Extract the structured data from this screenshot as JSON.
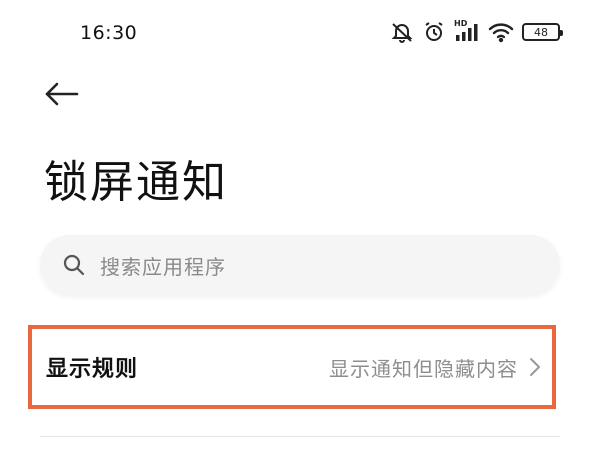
{
  "status_bar": {
    "time": "16:30",
    "icons": [
      "bell-muted-icon",
      "alarm-icon",
      "signal-hd-icon",
      "wifi-icon"
    ],
    "hd_label": "HD",
    "battery_level": "48"
  },
  "header": {
    "back_icon": "arrow-left-icon",
    "title": "锁屏通知"
  },
  "search": {
    "placeholder": "搜索应用程序",
    "icon": "search-icon"
  },
  "settings": {
    "rule_label": "显示规则",
    "rule_value": "显示通知但隐藏内容",
    "chevron_icon": "chevron-right-icon",
    "highlight_color": "#e8693f"
  }
}
